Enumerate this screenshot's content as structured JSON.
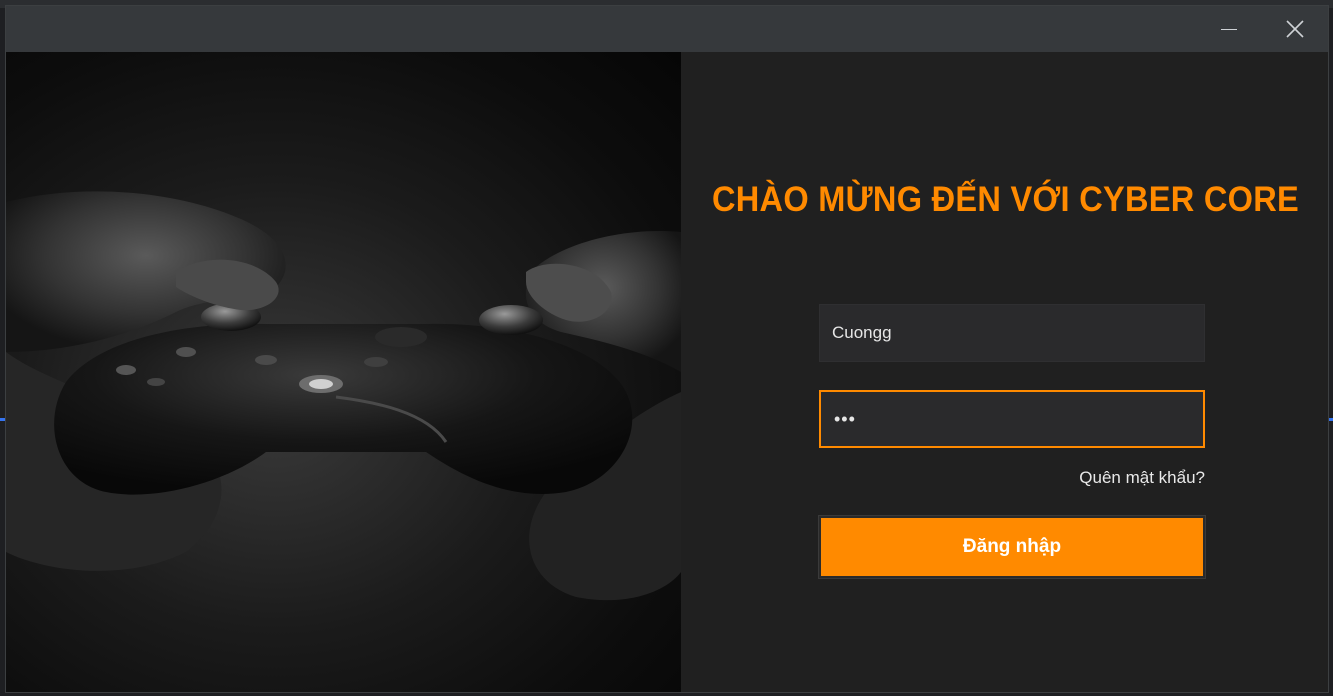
{
  "window": {
    "minimize_glyph": "—",
    "close_glyph": "✕"
  },
  "hero": {
    "image_description_icon": "gamepad-photo"
  },
  "login": {
    "welcome_title": "CHÀO MỪNG ĐẾN VỚI CYBER CORE",
    "username_value": "Cuongg",
    "password_value": "•••",
    "forgot_password_label": "Quên mật khẩu?",
    "login_button_label": "Đăng nhập"
  },
  "colors": {
    "accent": "#ff8a00",
    "panel_bg": "#202020",
    "titlebar_bg": "#36393c",
    "field_bg": "#2a2a2c"
  }
}
